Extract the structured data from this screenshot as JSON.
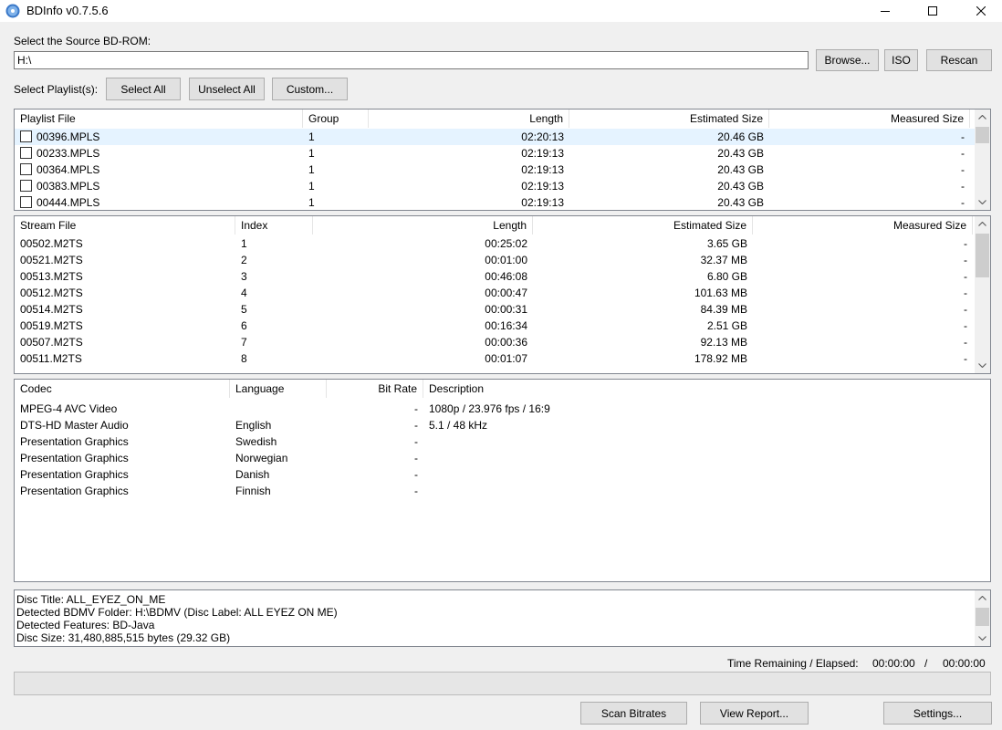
{
  "window": {
    "title": "BDInfo v0.7.5.6"
  },
  "source": {
    "label": "Select the Source BD-ROM:",
    "value": "H:\\",
    "browse_label": "Browse...",
    "iso_label": "ISO",
    "rescan_label": "Rescan"
  },
  "playlist_select": {
    "label": "Select Playlist(s):",
    "select_all_label": "Select All",
    "unselect_all_label": "Unselect All",
    "custom_label": "Custom..."
  },
  "playlists": {
    "columns": [
      "Playlist File",
      "Group",
      "Length",
      "Estimated Size",
      "Measured Size"
    ],
    "rows": [
      {
        "file": "00396.MPLS",
        "group": "1",
        "length": "02:20:13",
        "est": "20.46 GB",
        "meas": "-"
      },
      {
        "file": "00233.MPLS",
        "group": "1",
        "length": "02:19:13",
        "est": "20.43 GB",
        "meas": "-"
      },
      {
        "file": "00364.MPLS",
        "group": "1",
        "length": "02:19:13",
        "est": "20.43 GB",
        "meas": "-"
      },
      {
        "file": "00383.MPLS",
        "group": "1",
        "length": "02:19:13",
        "est": "20.43 GB",
        "meas": "-"
      },
      {
        "file": "00444.MPLS",
        "group": "1",
        "length": "02:19:13",
        "est": "20.43 GB",
        "meas": "-"
      }
    ]
  },
  "streams": {
    "columns": [
      "Stream File",
      "Index",
      "Length",
      "Estimated Size",
      "Measured Size"
    ],
    "rows": [
      {
        "file": "00502.M2TS",
        "index": "1",
        "length": "00:25:02",
        "est": "3.65 GB",
        "meas": "-"
      },
      {
        "file": "00521.M2TS",
        "index": "2",
        "length": "00:01:00",
        "est": "32.37 MB",
        "meas": "-"
      },
      {
        "file": "00513.M2TS",
        "index": "3",
        "length": "00:46:08",
        "est": "6.80 GB",
        "meas": "-"
      },
      {
        "file": "00512.M2TS",
        "index": "4",
        "length": "00:00:47",
        "est": "101.63 MB",
        "meas": "-"
      },
      {
        "file": "00514.M2TS",
        "index": "5",
        "length": "00:00:31",
        "est": "84.39 MB",
        "meas": "-"
      },
      {
        "file": "00519.M2TS",
        "index": "6",
        "length": "00:16:34",
        "est": "2.51 GB",
        "meas": "-"
      },
      {
        "file": "00507.M2TS",
        "index": "7",
        "length": "00:00:36",
        "est": "92.13 MB",
        "meas": "-"
      },
      {
        "file": "00511.M2TS",
        "index": "8",
        "length": "00:01:07",
        "est": "178.92 MB",
        "meas": "-"
      }
    ]
  },
  "codecs": {
    "columns": [
      "Codec",
      "Language",
      "Bit Rate",
      "Description"
    ],
    "rows": [
      {
        "codec": "MPEG-4 AVC Video",
        "lang": "",
        "bitrate": "-",
        "desc": "1080p / 23.976 fps / 16:9"
      },
      {
        "codec": "DTS-HD Master Audio",
        "lang": "English",
        "bitrate": "-",
        "desc": "5.1 / 48 kHz"
      },
      {
        "codec": "Presentation Graphics",
        "lang": "Swedish",
        "bitrate": "-",
        "desc": ""
      },
      {
        "codec": "Presentation Graphics",
        "lang": "Norwegian",
        "bitrate": "-",
        "desc": ""
      },
      {
        "codec": "Presentation Graphics",
        "lang": "Danish",
        "bitrate": "-",
        "desc": ""
      },
      {
        "codec": "Presentation Graphics",
        "lang": "Finnish",
        "bitrate": "-",
        "desc": ""
      }
    ]
  },
  "disc_info": {
    "lines": [
      "Disc Title: ALL_EYEZ_ON_ME",
      "Detected BDMV Folder: H:\\BDMV (Disc Label: ALL EYEZ ON ME)",
      "Detected Features: BD-Java",
      "Disc Size: 31,480,885,515 bytes (29.32 GB)"
    ]
  },
  "status": {
    "time_label": "Time Remaining / Elapsed:",
    "remaining": "00:00:00",
    "separator": "/",
    "elapsed": "00:00:00"
  },
  "actions": {
    "scan_label": "Scan Bitrates",
    "report_label": "View Report...",
    "settings_label": "Settings..."
  }
}
